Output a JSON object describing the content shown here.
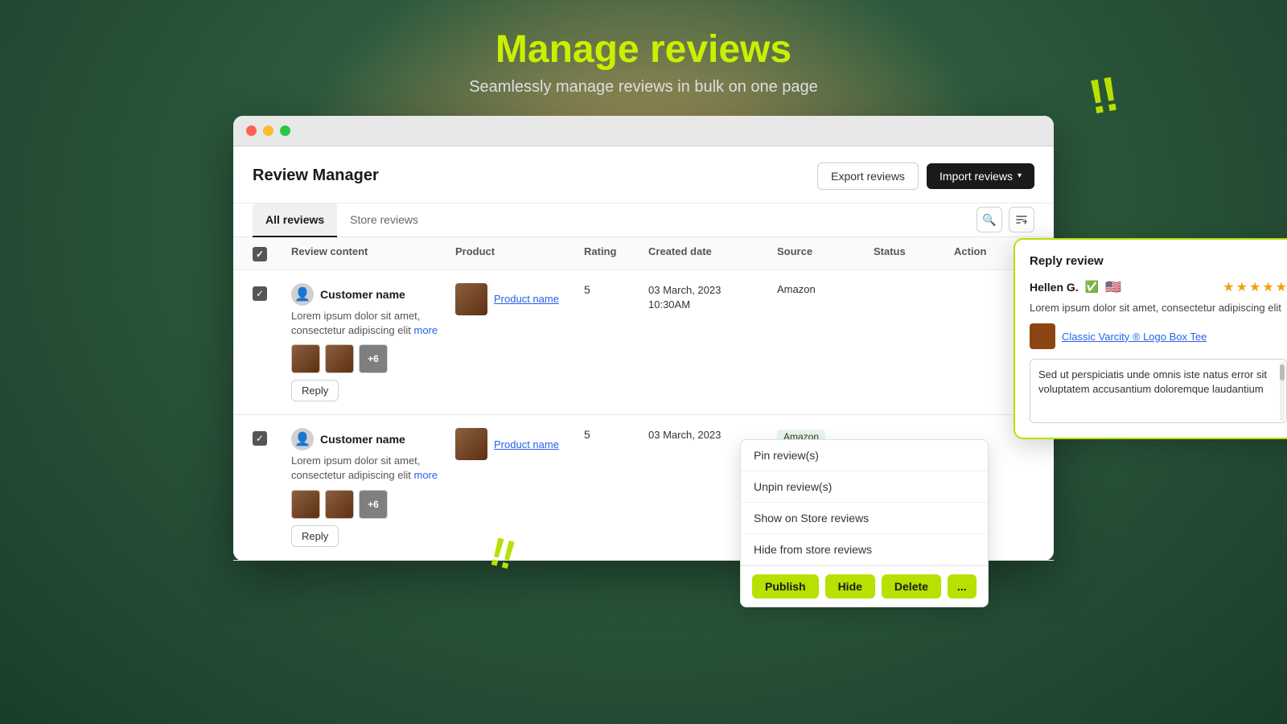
{
  "page": {
    "title": "Manage reviews",
    "subtitle": "Seamlessly manage reviews in bulk on one page"
  },
  "app": {
    "title": "Review Manager",
    "export_btn": "Export reviews",
    "import_btn": "Import reviews"
  },
  "tabs": {
    "all_reviews": "All reviews",
    "store_reviews": "Store reviews"
  },
  "table": {
    "headers": {
      "review_content": "Review content",
      "product": "Product",
      "rating": "Rating",
      "created_date": "Created date",
      "source": "Source",
      "status": "Status",
      "action": "Action"
    },
    "rows": [
      {
        "customer_name": "Customer name",
        "review_text": "Lorem ipsum dolor sit amet, consectetur adipiscing elit",
        "more_text": "more",
        "product_name": "Product name",
        "rating": "5",
        "date": "03 March, 2023",
        "time": "10:30AM",
        "source": "Amazon",
        "reply_btn": "Reply"
      },
      {
        "customer_name": "Customer name",
        "review_text": "Lorem ipsum dolor sit amet, consectetur adipiscing elit",
        "more_text": "more",
        "product_name": "Product name",
        "rating": "5",
        "date": "03 March, 2023",
        "time": "",
        "source": "Amazon",
        "reply_btn": "Reply"
      }
    ]
  },
  "dropdown": {
    "items": [
      "Pin review(s)",
      "Unpin review(s)",
      "Show on Store reviews",
      "Hide from store reviews"
    ]
  },
  "action_bar": {
    "publish": "Publish",
    "hide": "Hide",
    "delete": "Delete",
    "more": "..."
  },
  "reply_panel": {
    "title": "Reply review",
    "reviewer_name": "Hellen G.",
    "review_text": "Lorem ipsum dolor sit amet, consectetur adipiscing elit",
    "product_name": "Classic Varcity ® Logo Box Tee",
    "reply_placeholder": "Sed ut perspiciatis unde omnis iste natus error sit voluptatem accusantium doloremque laudantium",
    "stars": 5
  }
}
